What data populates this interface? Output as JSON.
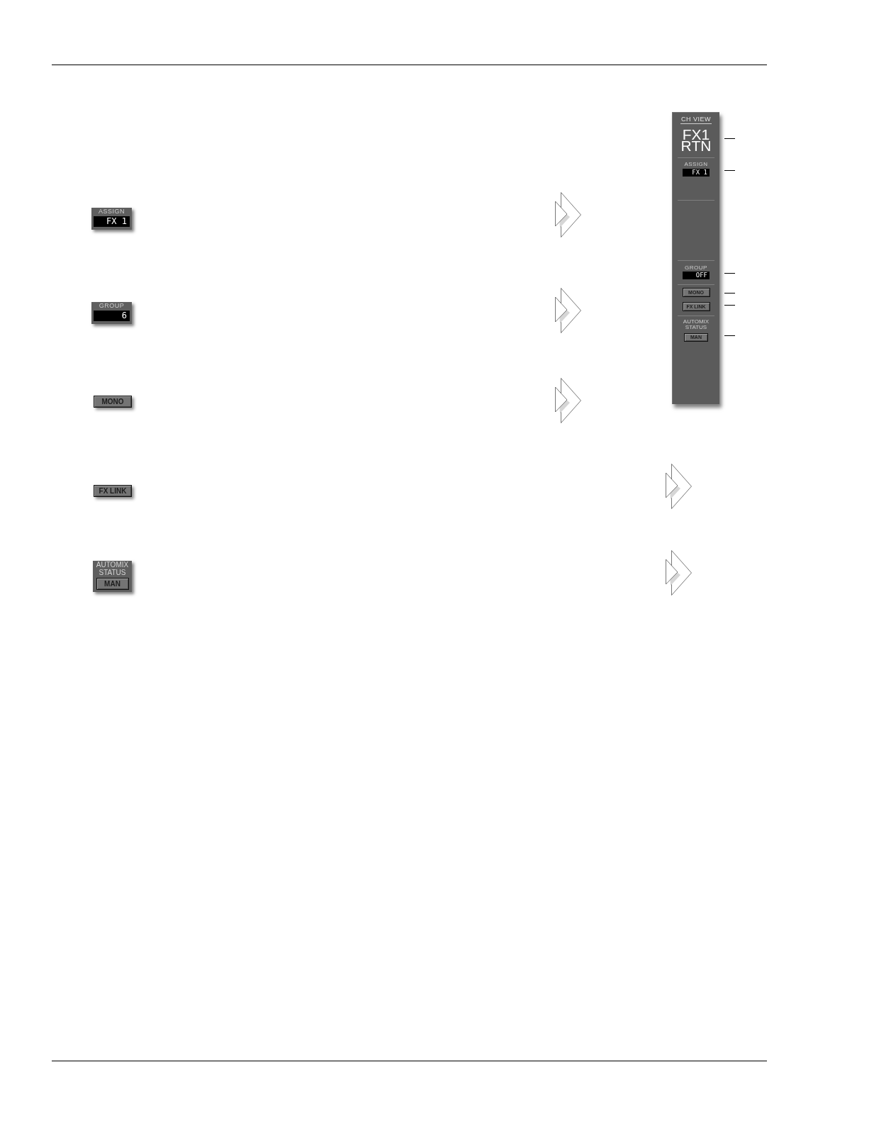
{
  "channel_view_panel": {
    "title": "CH VIEW",
    "channel_name": "FX1 RTN",
    "assign": {
      "label": "ASSIGN",
      "value": "FX 1"
    },
    "group": {
      "label": "GROUP",
      "value": "OFF"
    },
    "buttons": [
      "MONO",
      "FX LINK"
    ],
    "automix": {
      "label": "AUTOMIX STATUS",
      "value": "MAN"
    }
  },
  "features": [
    {
      "kind": "display",
      "label": "ASSIGN",
      "value": "FX 1"
    },
    {
      "kind": "display",
      "label": "GROUP",
      "value": "6"
    },
    {
      "kind": "button",
      "text": "MONO"
    },
    {
      "kind": "button",
      "text": "FX LINK"
    },
    {
      "kind": "status",
      "label": "AUTOMIX STATUS",
      "value": "MAN"
    }
  ]
}
